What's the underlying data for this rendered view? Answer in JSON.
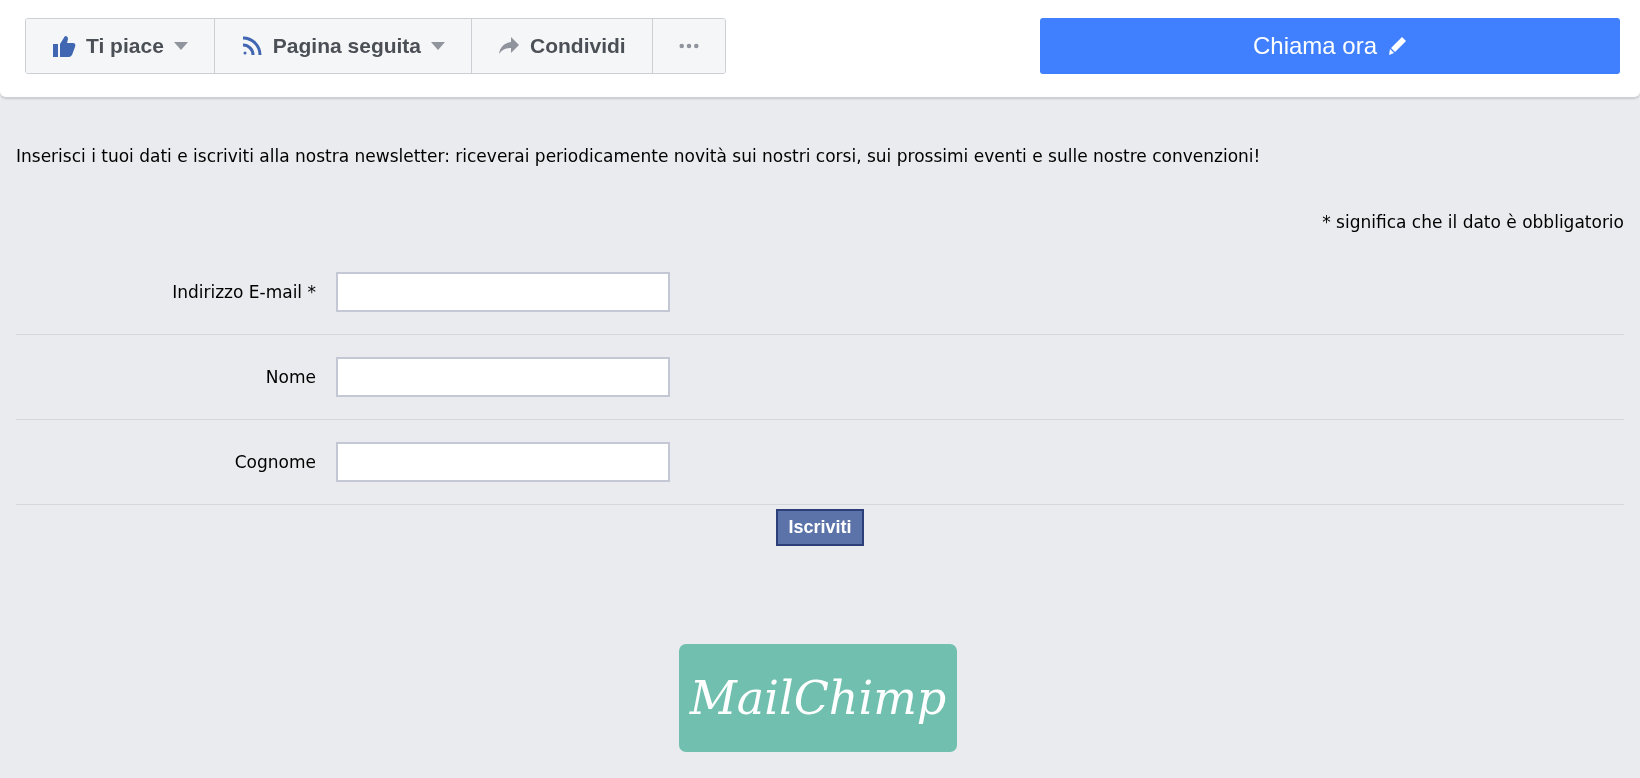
{
  "toolbar": {
    "buttons": [
      {
        "kind": "like",
        "label": "Ti piace",
        "dropdown": true
      },
      {
        "kind": "follow",
        "label": "Pagina seguita",
        "dropdown": true
      },
      {
        "kind": "share",
        "label": "Condividi",
        "dropdown": false
      },
      {
        "kind": "more",
        "dropdown": false
      }
    ],
    "call_button": {
      "label": "Chiama ora"
    }
  },
  "intro": "Inserisci i tuoi dati e iscriviti alla nostra newsletter: riceverai periodicamente novità sui nostri corsi, sui prossimi eventi e sulle nostre convenzioni!",
  "required_note": "* significa che il dato è obbligatorio",
  "fields": [
    {
      "label": "Indirizzo E-mail *"
    },
    {
      "label": "Nome"
    },
    {
      "label": "Cognome"
    }
  ],
  "submit": "Iscriviti",
  "logo": {
    "text": "MailChimp"
  }
}
